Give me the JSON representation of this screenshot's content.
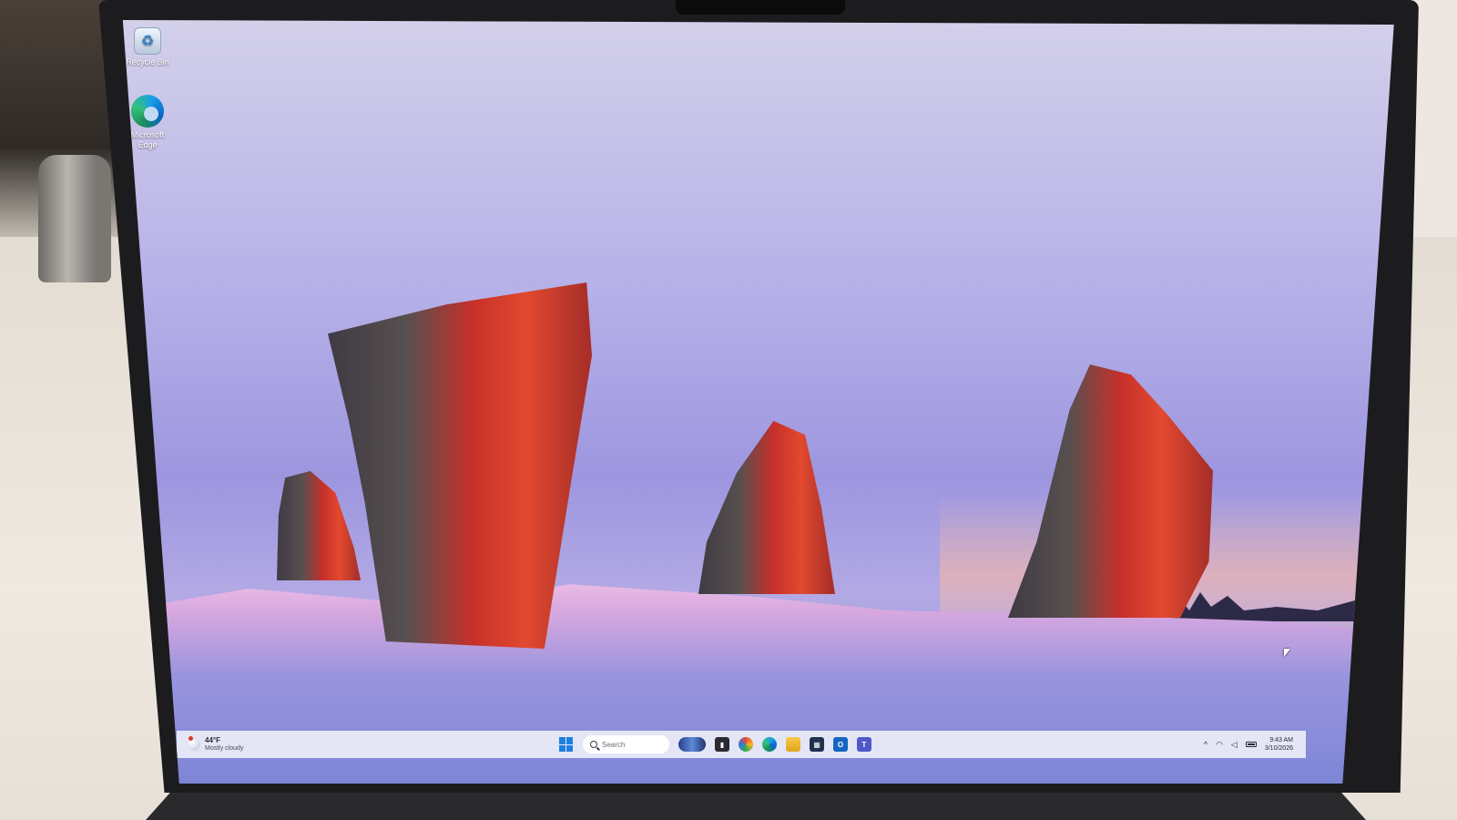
{
  "desktop": {
    "icons": [
      {
        "label": "Recycle Bin",
        "icon": "recycle-bin-icon"
      },
      {
        "label": "Microsoft Edge",
        "icon": "edge-icon"
      }
    ]
  },
  "taskbar": {
    "weather": {
      "temperature": "44°F",
      "condition": "Mostly cloudy"
    },
    "search": {
      "placeholder": "Search"
    },
    "apps": [
      "widgets-icon",
      "tv-icon",
      "copilot-icon",
      "edge-icon",
      "file-explorer-icon",
      "store-icon",
      "outlook-icon",
      "teams-icon"
    ],
    "tray": {
      "chevron": "^",
      "time": "9:43 AM",
      "date": "3/10/2026"
    }
  },
  "colors": {
    "accent": "#1e7fe0",
    "taskbar_bg": "#eceef8"
  }
}
